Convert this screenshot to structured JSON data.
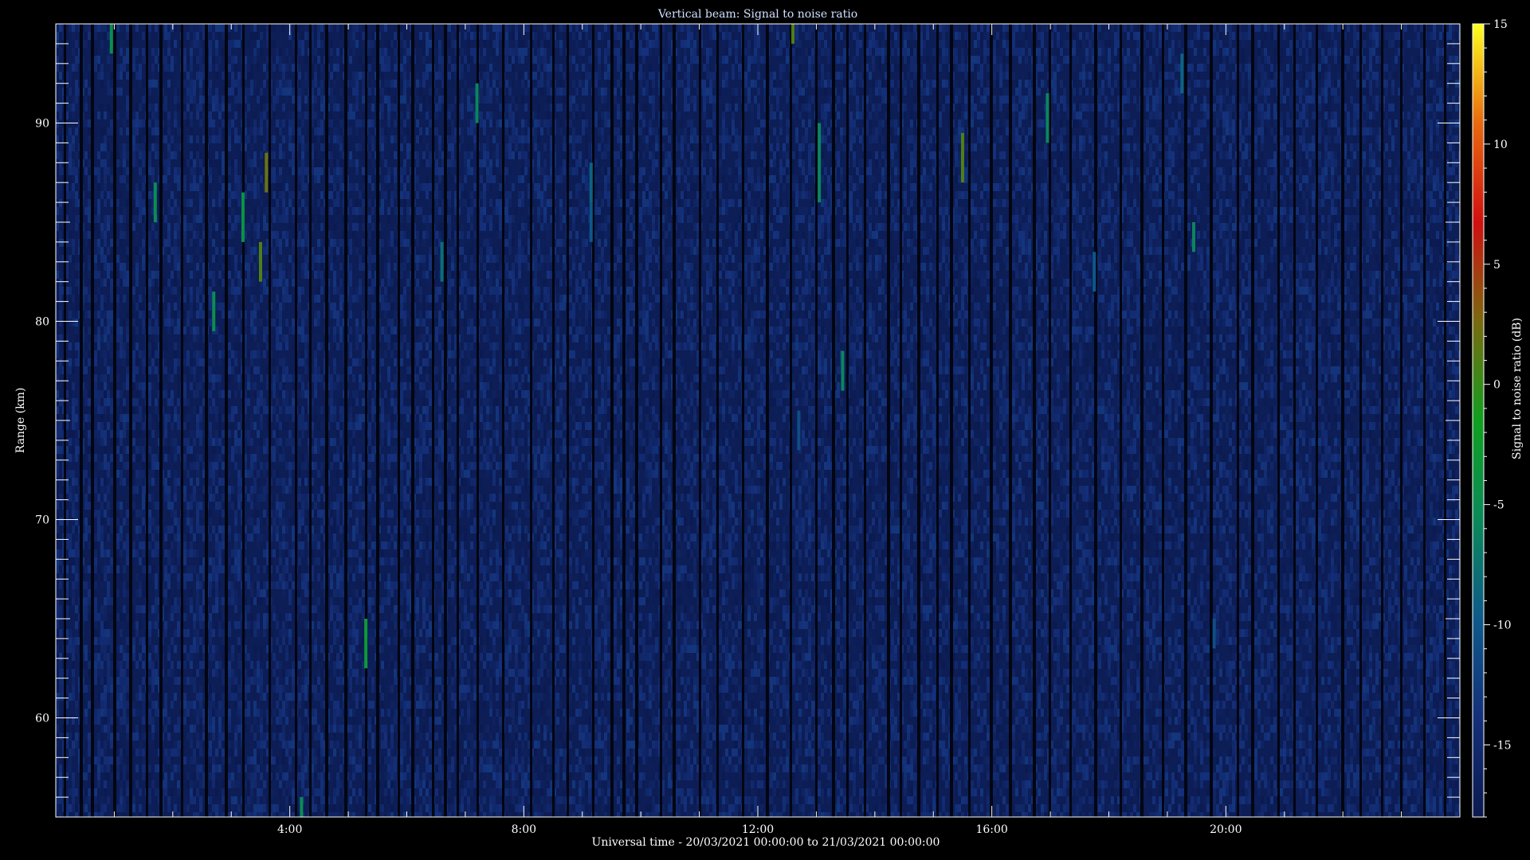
{
  "chart_data": {
    "type": "heatmap",
    "title": "Vertical beam: Signal to noise ratio",
    "xlabel": "Universal time - 20/03/2021 00:00:00 to 21/03/2021 00:00:00",
    "ylabel": "Range (km)",
    "colorbar_label": "Signal to noise ratio (dB)",
    "xlim_hours": [
      0,
      24
    ],
    "ylim_km": [
      55,
      95
    ],
    "x_ticks": [
      {
        "hour": 4,
        "label": "4:00"
      },
      {
        "hour": 8,
        "label": "8:00"
      },
      {
        "hour": 12,
        "label": "12:00"
      },
      {
        "hour": 16,
        "label": "16:00"
      },
      {
        "hour": 20,
        "label": "20:00"
      }
    ],
    "y_ticks": [
      {
        "km": 60,
        "label": "60"
      },
      {
        "km": 70,
        "label": "70"
      },
      {
        "km": 80,
        "label": "80"
      },
      {
        "km": 90,
        "label": "90"
      }
    ],
    "colorbar_range_db": [
      -18,
      15
    ],
    "colorbar_ticks": [
      {
        "db": 15,
        "label": "15"
      },
      {
        "db": 10,
        "label": "10"
      },
      {
        "db": 5,
        "label": "5"
      },
      {
        "db": 0,
        "label": "0"
      },
      {
        "db": -5,
        "label": "-5"
      },
      {
        "db": -10,
        "label": "-10"
      },
      {
        "db": -15,
        "label": "-15"
      }
    ],
    "colormap": [
      "#0b1a50",
      "#14307a",
      "#0e5a8a",
      "#0a8a5a",
      "#10a020",
      "#7a6a10",
      "#d01010",
      "#e86a10",
      "#ffff20"
    ],
    "background_snr_db": -16,
    "strong_echoes": [
      {
        "hour": 0.95,
        "km_from": 93.5,
        "km_to": 95,
        "snr_db": -5
      },
      {
        "hour": 1.7,
        "km_from": 85,
        "km_to": 87,
        "snr_db": -5
      },
      {
        "hour": 2.7,
        "km_from": 79.5,
        "km_to": 81.5,
        "snr_db": -5
      },
      {
        "hour": 3.2,
        "km_from": 84,
        "km_to": 86.5,
        "snr_db": -4
      },
      {
        "hour": 3.5,
        "km_from": 82,
        "km_to": 84,
        "snr_db": 1
      },
      {
        "hour": 3.6,
        "km_from": 86.5,
        "km_to": 88.5,
        "snr_db": 2
      },
      {
        "hour": 4.2,
        "km_from": 55,
        "km_to": 56,
        "snr_db": -5
      },
      {
        "hour": 5.3,
        "km_from": 62.5,
        "km_to": 65,
        "snr_db": -3
      },
      {
        "hour": 6.6,
        "km_from": 82,
        "km_to": 84,
        "snr_db": -8
      },
      {
        "hour": 7.2,
        "km_from": 90,
        "km_to": 92,
        "snr_db": -6
      },
      {
        "hour": 9.15,
        "km_from": 84,
        "km_to": 86,
        "snr_db": -10
      },
      {
        "hour": 9.15,
        "km_from": 86,
        "km_to": 88,
        "snr_db": -9
      },
      {
        "hour": 12.6,
        "km_from": 94,
        "km_to": 95,
        "snr_db": 1
      },
      {
        "hour": 12.7,
        "km_from": 73.5,
        "km_to": 75.5,
        "snr_db": -11
      },
      {
        "hour": 13.05,
        "km_from": 86,
        "km_to": 90,
        "snr_db": -6
      },
      {
        "hour": 13.45,
        "km_from": 76.5,
        "km_to": 78.5,
        "snr_db": -6
      },
      {
        "hour": 15.5,
        "km_from": 87,
        "km_to": 89.5,
        "snr_db": 1
      },
      {
        "hour": 16.95,
        "km_from": 89,
        "km_to": 91.5,
        "snr_db": -6
      },
      {
        "hour": 17.75,
        "km_from": 81.5,
        "km_to": 83.5,
        "snr_db": -10
      },
      {
        "hour": 19.25,
        "km_from": 91.5,
        "km_to": 93.5,
        "snr_db": -9
      },
      {
        "hour": 19.45,
        "km_from": 83.5,
        "km_to": 85,
        "snr_db": -6
      },
      {
        "hour": 19.8,
        "km_from": 63.5,
        "km_to": 65,
        "snr_db": -11
      }
    ],
    "grid": false,
    "legend": "colorbar-right"
  }
}
